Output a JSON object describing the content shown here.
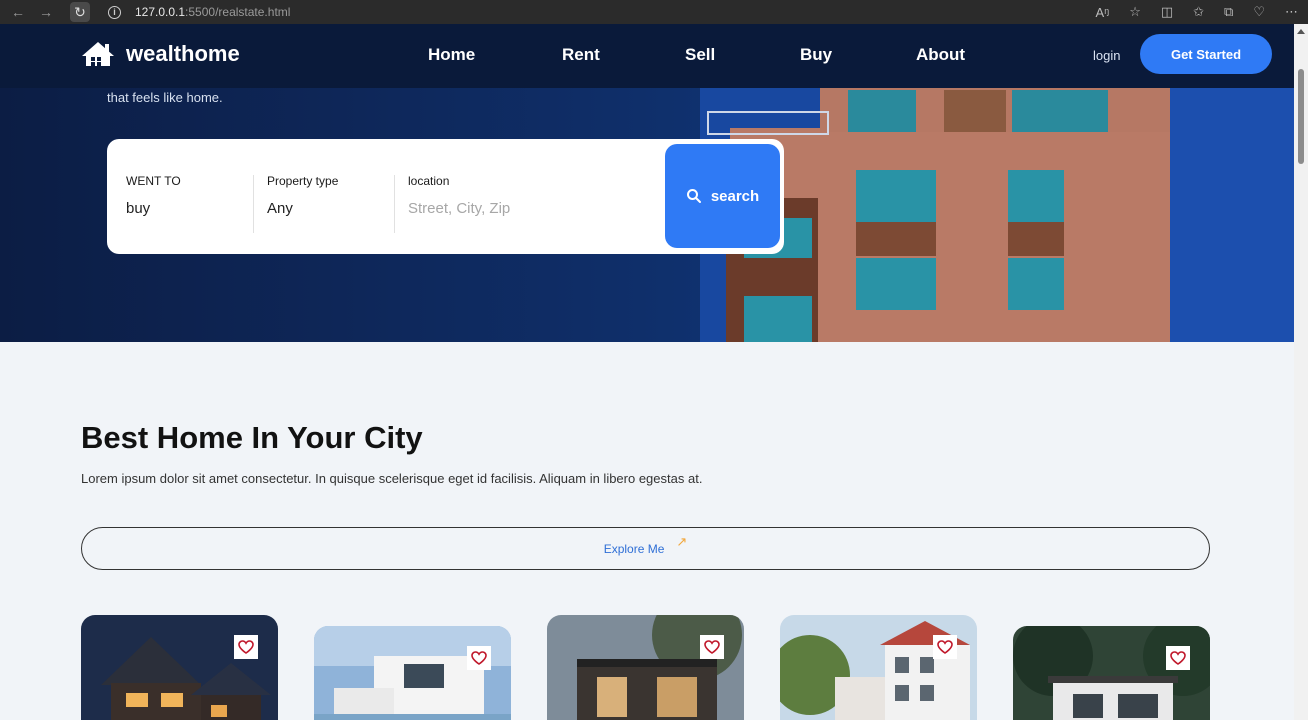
{
  "browser": {
    "url_host": "127.0.0.1",
    "url_rest": ":5500/realstate.html"
  },
  "header": {
    "brand": "wealthome",
    "nav": [
      "Home",
      "Rent",
      "Sell",
      "Buy",
      "About"
    ],
    "login": "login",
    "cta": "Get Started"
  },
  "hero": {
    "tagline": "that feels like home."
  },
  "search": {
    "fields": [
      {
        "label": "WENT TO",
        "value": "buy"
      },
      {
        "label": "Property type",
        "value": "Any"
      },
      {
        "label": "location",
        "placeholder": "Street, City, Zip"
      }
    ],
    "button": "search"
  },
  "section": {
    "title": "Best Home In Your City",
    "description": "Lorem ipsum dolor sit amet consectetur. In quisque scelerisque eget id facilisis. Aliquam in libero egestas at.",
    "explore": "Explore Me"
  },
  "colors": {
    "accent": "#2f7af5",
    "header_bg": "#0a1a3a",
    "heart": "#c0182b"
  }
}
